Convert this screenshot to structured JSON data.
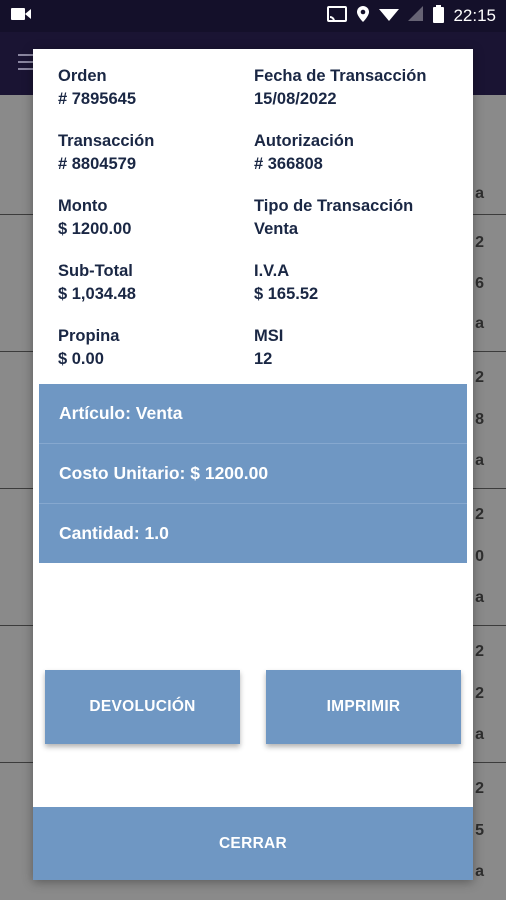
{
  "status_bar": {
    "time": "22:15",
    "icons": [
      "video-icon",
      "cast-icon",
      "location-icon",
      "wifi-icon",
      "battery-icon"
    ]
  },
  "background": {
    "row_fragments": [
      "a",
      "2",
      "6",
      "a",
      "2",
      "8",
      "a",
      "2",
      "0",
      "a",
      "2",
      "2",
      "a",
      "2",
      "5",
      "a"
    ]
  },
  "dialog": {
    "fields": [
      {
        "label": "Orden",
        "value": "# 7895645"
      },
      {
        "label": "Fecha de Transacción",
        "value": "15/08/2022"
      },
      {
        "label": "Transacción",
        "value": "# 8804579"
      },
      {
        "label": "Autorización",
        "value": "# 366808"
      },
      {
        "label": "Monto",
        "value": "$ 1200.00"
      },
      {
        "label": "Tipo de Transacción",
        "value": "Venta"
      },
      {
        "label": "Sub-Total",
        "value": "$ 1,034.48"
      },
      {
        "label": "I.V.A",
        "value": "$ 165.52"
      },
      {
        "label": "Propina",
        "value": "$ 0.00"
      },
      {
        "label": "MSI",
        "value": "12"
      }
    ],
    "items": [
      "Artículo: Venta",
      "Costo Unitario: $ 1200.00",
      "Cantidad: 1.0"
    ],
    "buttons": {
      "refund_label": "DEVOLUCIÓN",
      "print_label": "IMPRIMIR",
      "close_label": "CERRAR"
    }
  },
  "colors": {
    "accent": "#6f97c3",
    "text": "#1a2744",
    "status_bar": "#14102a"
  }
}
